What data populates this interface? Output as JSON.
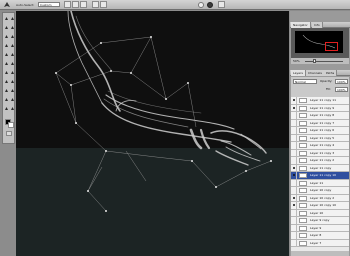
{
  "options_bar": {
    "tool_icon": "pen-tool-icon",
    "auto_select_label": "Auto-Select:",
    "auto_select_value": "Custom",
    "cancel_icon": "cancel-icon",
    "commit_icon": "commit-check-icon"
  },
  "toolbox": {
    "tools": [
      "marquee",
      "move",
      "lasso",
      "magic-wand",
      "crop",
      "slice",
      "healing-brush",
      "brush",
      "clone-stamp",
      "history-brush",
      "eraser",
      "gradient",
      "blur",
      "dodge",
      "pen",
      "type",
      "path-selection",
      "shape",
      "notes",
      "eyedropper",
      "hand",
      "zoom"
    ],
    "foreground_color": "#000000",
    "background_color": "#ffffff"
  },
  "navigator": {
    "tabs": [
      "Navigator",
      "Info"
    ],
    "zoom": "50%"
  },
  "layers": {
    "tabs": [
      "Layers",
      "Channels",
      "Paths"
    ],
    "blend_mode": "Normal",
    "opacity_label": "Opacity:",
    "opacity_value": "100%",
    "fill_label": "Fill:",
    "fill_value": "100%",
    "items": [
      {
        "name": "Layer 11 copy 11",
        "visible": true,
        "selected": false
      },
      {
        "name": "Layer 11 copy 9",
        "visible": true,
        "selected": false
      },
      {
        "name": "Layer 11 copy 8",
        "visible": false,
        "selected": false
      },
      {
        "name": "Layer 11 copy 7",
        "visible": false,
        "selected": false
      },
      {
        "name": "Layer 11 copy 6",
        "visible": false,
        "selected": false
      },
      {
        "name": "Layer 11 copy 5",
        "visible": false,
        "selected": false
      },
      {
        "name": "Layer 11 copy 4",
        "visible": false,
        "selected": false
      },
      {
        "name": "Layer 11 copy 3",
        "visible": false,
        "selected": false
      },
      {
        "name": "Layer 11 copy 2",
        "visible": false,
        "selected": false
      },
      {
        "name": "Layer 11 copy",
        "visible": true,
        "selected": false
      },
      {
        "name": "Layer 11 copy 10",
        "visible": true,
        "selected": true
      },
      {
        "name": "Layer 11",
        "visible": false,
        "selected": false
      },
      {
        "name": "Layer 10 copy",
        "visible": false,
        "selected": false
      },
      {
        "name": "Layer 10 copy 2",
        "visible": true,
        "selected": false
      },
      {
        "name": "Layer 10 copy 10",
        "visible": true,
        "selected": false
      },
      {
        "name": "Layer 10",
        "visible": false,
        "selected": false
      },
      {
        "name": "Layer 9 copy",
        "visible": false,
        "selected": false
      },
      {
        "name": "Layer 9",
        "visible": false,
        "selected": false
      },
      {
        "name": "Layer 8",
        "visible": false,
        "selected": false
      },
      {
        "name": "Layer 7",
        "visible": false,
        "selected": false
      }
    ]
  }
}
